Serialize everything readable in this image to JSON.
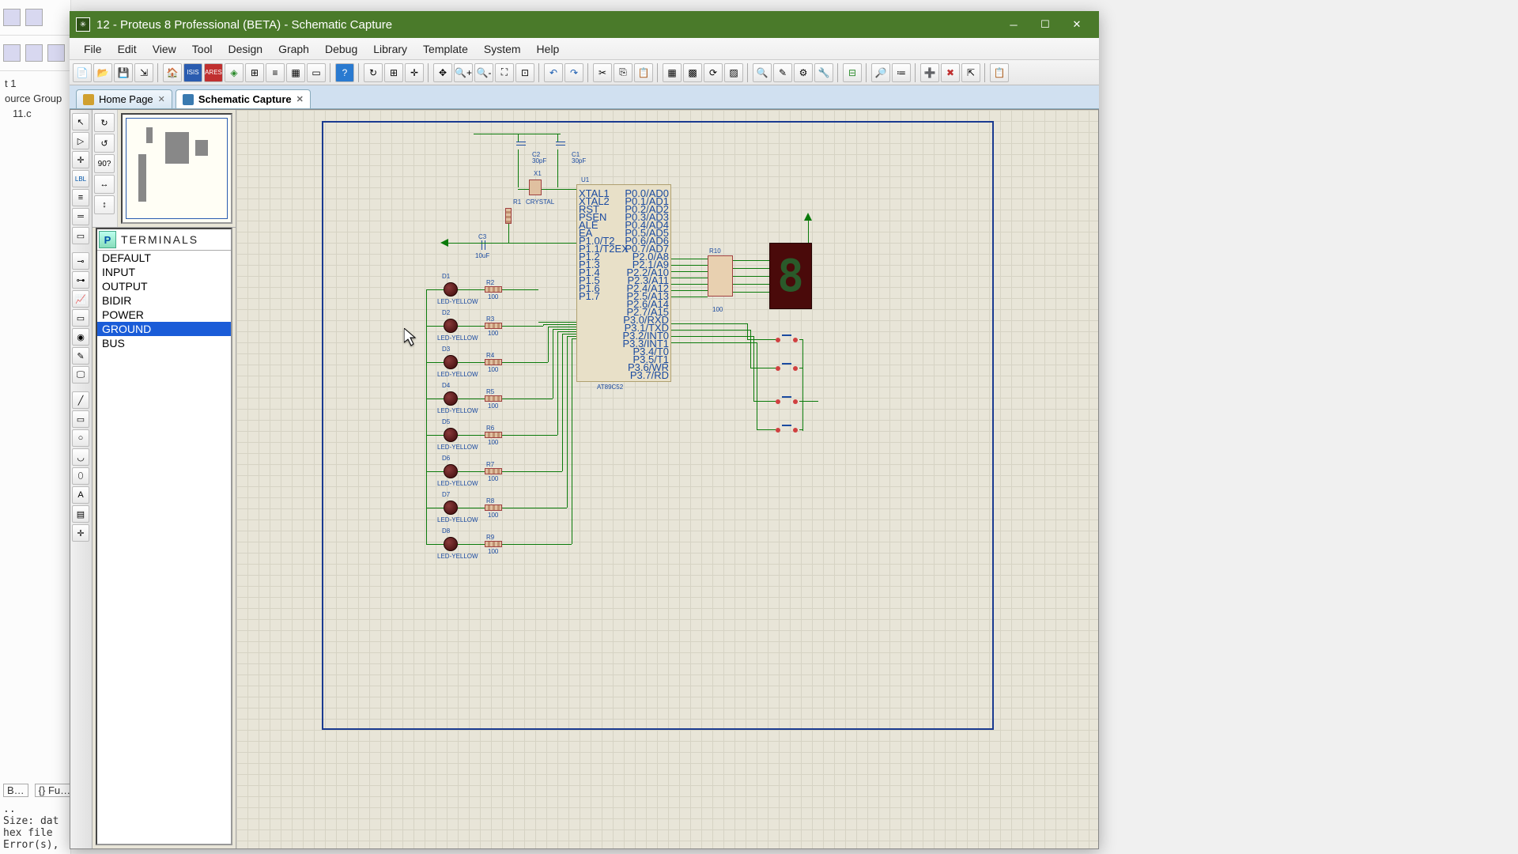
{
  "bg": {
    "tree1": "t 1",
    "tree2": "ource Group",
    "tree3": "11.c",
    "btn_fu": "{} Fu…",
    "log1": "Size: dat",
    "log2": "hex file",
    "log3": "Error(s),"
  },
  "titlebar": {
    "title": "12 - Proteus 8 Professional (BETA) - Schematic Capture"
  },
  "menu": {
    "file": "File",
    "edit": "Edit",
    "view": "View",
    "tool": "Tool",
    "design": "Design",
    "graph": "Graph",
    "debug": "Debug",
    "library": "Library",
    "template": "Template",
    "system": "System",
    "help": "Help"
  },
  "tabs": {
    "home": "Home Page",
    "schem": "Schematic Capture"
  },
  "rotate_angle": "90?",
  "terminals": {
    "title": "TERMINALS",
    "items": [
      "DEFAULT",
      "INPUT",
      "OUTPUT",
      "BIDIR",
      "POWER",
      "GROUND",
      "BUS"
    ],
    "selected_index": 5
  },
  "schematic": {
    "chip_ref": "U1",
    "chip_part": "AT89C52",
    "crystal": "CRYSTAL",
    "x1": "X1",
    "c1": "C1",
    "c1v": "30pF",
    "c2": "C2",
    "c2v": "30pF",
    "c3": "C3",
    "c3v": "10uF",
    "r1": "R1",
    "r10": "R10",
    "r_val": "100",
    "leds": [
      {
        "ref": "D1",
        "r": "R2"
      },
      {
        "ref": "D2",
        "r": "R3"
      },
      {
        "ref": "D3",
        "r": "R4"
      },
      {
        "ref": "D4",
        "r": "R5"
      },
      {
        "ref": "D5",
        "r": "R6"
      },
      {
        "ref": "D6",
        "r": "R7"
      },
      {
        "ref": "D7",
        "r": "R8"
      },
      {
        "ref": "D8",
        "r": "R9"
      }
    ],
    "led_part": "LED-YELLOW",
    "pins_left": [
      "XTAL1",
      "",
      "XTAL2",
      "",
      "RST",
      "",
      "",
      "PSEN",
      "ALE",
      "EA",
      "",
      "",
      "P1.0/T2",
      "P1.1/T2EX",
      "P1.2",
      "P1.3",
      "P1.4",
      "P1.5",
      "P1.6",
      "P1.7"
    ],
    "pins_right": [
      "P0.0/AD0",
      "P0.1/AD1",
      "P0.2/AD2",
      "P0.3/AD3",
      "P0.4/AD4",
      "P0.5/AD5",
      "P0.6/AD6",
      "P0.7/AD7",
      "",
      "P2.0/A8",
      "P2.1/A9",
      "P2.2/A10",
      "P2.3/A11",
      "P2.4/A12",
      "P2.5/A13",
      "P2.6/A14",
      "P2.7/A15",
      "",
      "P3.0/RXD",
      "P3.1/TXD",
      "P3.2/INT0",
      "P3.3/INT1",
      "P3.4/T0",
      "P3.5/T1",
      "P3.6/WR",
      "P3.7/RD"
    ]
  }
}
